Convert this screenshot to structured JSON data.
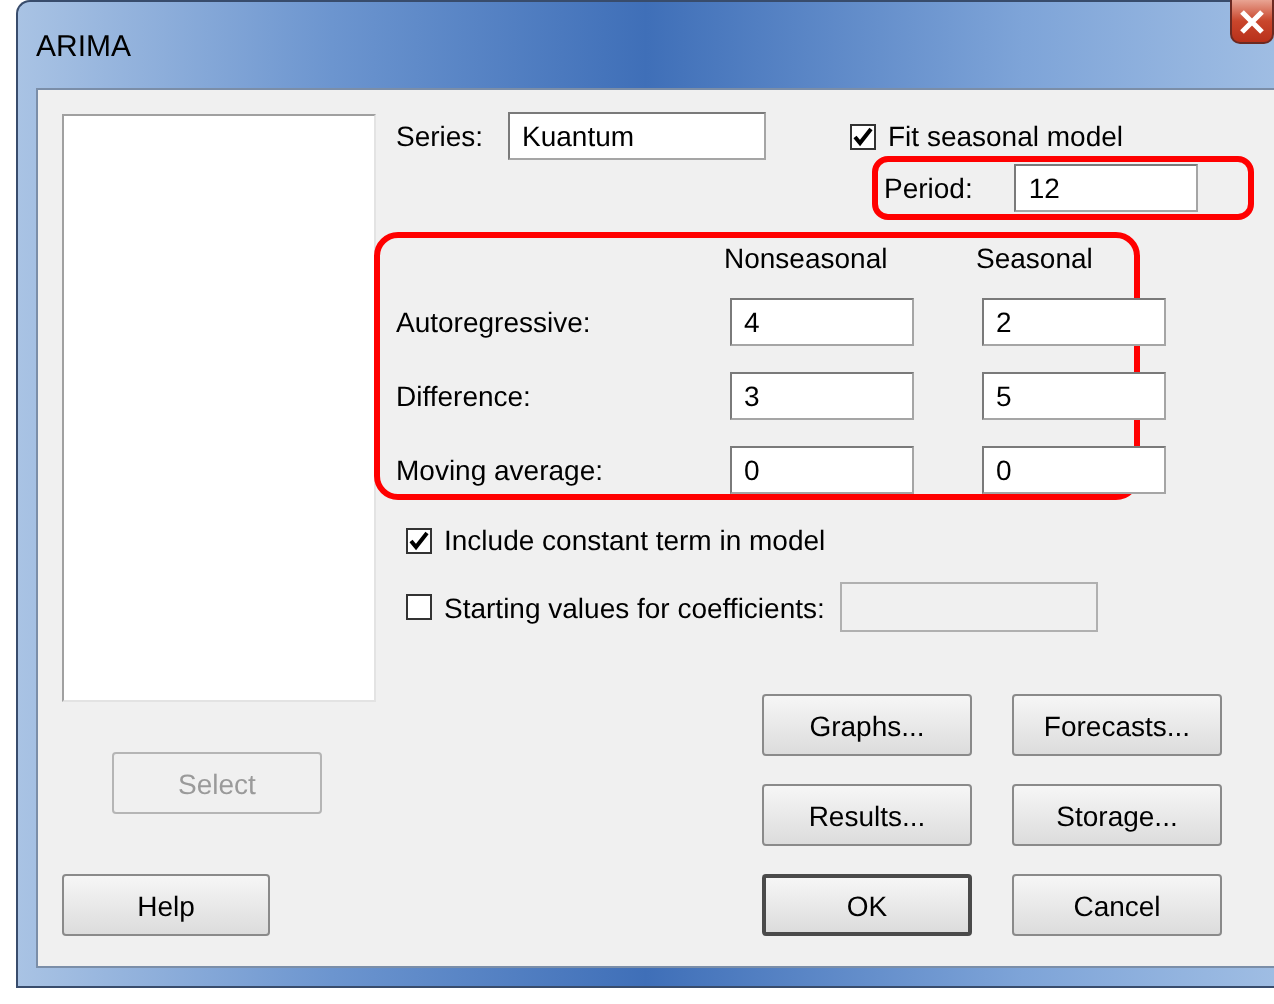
{
  "window": {
    "title": "ARIMA"
  },
  "series": {
    "label": "Series:",
    "value": "Kuantum"
  },
  "fit_seasonal": {
    "label": "Fit seasonal model",
    "checked": true
  },
  "period": {
    "label": "Period:",
    "value": "12",
    "highlighted": true
  },
  "orders": {
    "highlighted": true,
    "columns": [
      "Nonseasonal",
      "Seasonal"
    ],
    "rows": [
      {
        "label": "Autoregressive:",
        "nonseasonal": "4",
        "seasonal": "2"
      },
      {
        "label": "Difference:",
        "nonseasonal": "3",
        "seasonal": "5"
      },
      {
        "label": "Moving average:",
        "nonseasonal": "0",
        "seasonal": "0"
      }
    ]
  },
  "include_constant": {
    "label": "Include constant term in model",
    "checked": true
  },
  "starting_values": {
    "label": "Starting values for coefficients:",
    "checked": false,
    "field_disabled": true
  },
  "left_buttons": [
    {
      "label": "Select",
      "disabled": true
    },
    {
      "label": "Help",
      "disabled": false
    }
  ],
  "action_buttons": [
    {
      "label": "Graphs...",
      "default": false
    },
    {
      "label": "Forecasts...",
      "default": false
    },
    {
      "label": "Results...",
      "default": false
    },
    {
      "label": "Storage...",
      "default": false
    },
    {
      "label": "OK",
      "default": true
    },
    {
      "label": "Cancel",
      "default": false
    }
  ]
}
